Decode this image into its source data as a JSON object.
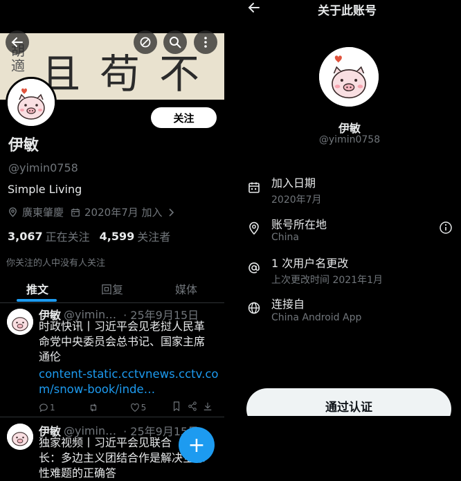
{
  "left": {
    "banner_text": "且苟不",
    "banner_side_text": "胡適",
    "follow_label": "关注",
    "name": "伊敏",
    "handle": "@yimin0758",
    "bio": "Simple Living",
    "location": "廣東肇慶",
    "joined": "2020年7月 加入",
    "following_count": "3,067",
    "following_label": "正在关注",
    "followers_count": "4,599",
    "followers_label": "关注者",
    "no_mutual": "你关注的人中没有人关注",
    "tabs": [
      "推文",
      "回复",
      "媒体"
    ],
    "tweets": [
      {
        "name": "伊敏",
        "handle": "@yimin…",
        "date": "· 25年9月15日",
        "text_lines": [
          "时政快讯丨习近平会见老挝人民革",
          "命党中央委员会总书记、国家主席",
          "通伦"
        ],
        "link_lines": [
          "content-static.cctvnews.cctv.co",
          "m/snow-book/inde…"
        ],
        "reply_count": "1",
        "like_count": "5"
      },
      {
        "name": "伊敏",
        "handle": "@yimin…",
        "date": "· 25年9月15日",
        "text_lines": [
          "独家视频丨习近平会见联合",
          "长：多边主义团结合作是解决全球",
          "性难题的正确答"
        ]
      }
    ],
    "fab_label": "+"
  },
  "right": {
    "title": "关于此账号",
    "name": "伊敏",
    "handle": "@yimin0758",
    "rows": [
      {
        "title": "加入日期",
        "sub": "2020年7月"
      },
      {
        "title": "账号所在地",
        "sub": "China"
      },
      {
        "title": "1 次用户名更改",
        "sub": "上次更改时间 2021年1月"
      },
      {
        "title": "连接自",
        "sub": "China Android App"
      }
    ],
    "verify_label": "通过认证"
  },
  "colors": {
    "accent": "#1d9bf0",
    "muted": "#71767b",
    "text": "#e7e9ea",
    "background": "#000000"
  }
}
